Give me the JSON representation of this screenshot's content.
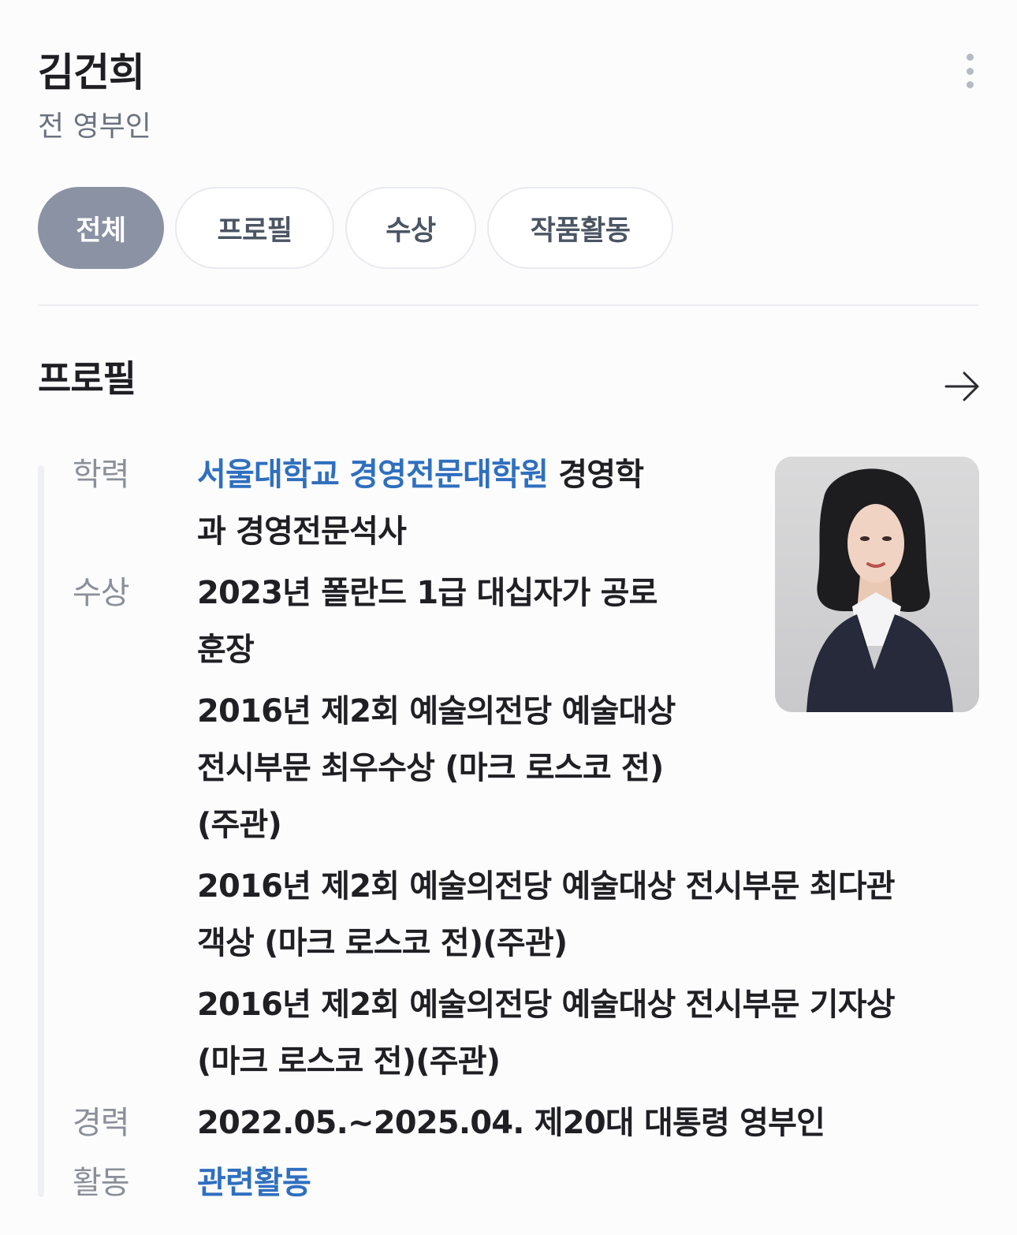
{
  "header": {
    "name": "김건희",
    "subtitle": "전 영부인"
  },
  "tabs": [
    {
      "label": "전체",
      "active": true
    },
    {
      "label": "프로필",
      "active": false
    },
    {
      "label": "수상",
      "active": false
    },
    {
      "label": "작품활동",
      "active": false
    }
  ],
  "profile": {
    "title": "프로필",
    "education": {
      "label": "학력",
      "link_text": "서울대학교 경영전문대학원",
      "line1_rest": " 경영학",
      "line2": "과 경영전문석사"
    },
    "awards": {
      "label": "수상",
      "items": [
        {
          "lines": [
            "2023년 폴란드 1급 대십자가 공로",
            "훈장"
          ]
        },
        {
          "lines": [
            "2016년 제2회 예술의전당 예술대상",
            "전시부문 최우수상 (마크 로스코 전)",
            "(주관)"
          ]
        },
        {
          "lines": [
            "2016년 제2회 예술의전당 예술대상 전시부문 최다관",
            "객상 (마크 로스코 전)(주관)"
          ]
        },
        {
          "lines": [
            "2016년 제2회 예술의전당 예술대상 전시부문 기자상",
            "(마크 로스코 전)(주관)"
          ]
        }
      ]
    },
    "career": {
      "label": "경력",
      "value": "2022.05.~2025.04. 제20대 대통령 영부인"
    },
    "activity": {
      "label": "활동",
      "link_text": "관련활동"
    }
  },
  "colors": {
    "link": "#2f6fbf",
    "active_tab": "#8b92a3",
    "label_gray": "#8a8f99"
  },
  "icons": {
    "more": "more-vertical-icon",
    "arrow": "arrow-right-icon"
  }
}
